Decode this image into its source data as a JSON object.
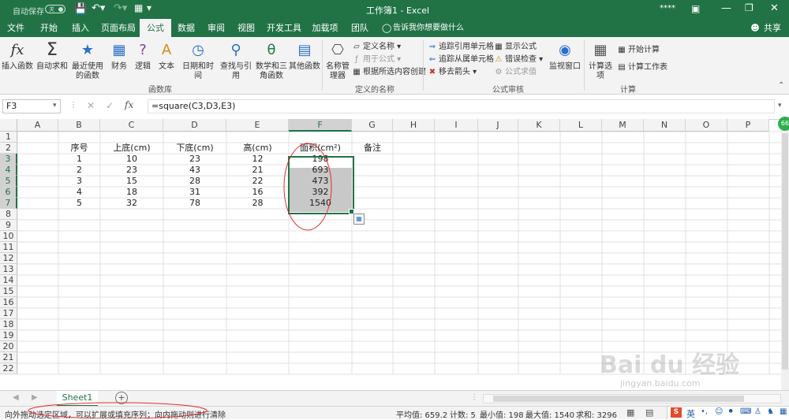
{
  "titlebar": {
    "autosave_label": "自动保存",
    "autosave_state": "关",
    "title": "工作簿1 - Excel",
    "user": "****",
    "bg_color": "#217346"
  },
  "tabs": [
    "文件",
    "开始",
    "插入",
    "页面布局",
    "公式",
    "数据",
    "审阅",
    "视图",
    "开发工具",
    "加载项",
    "团队"
  ],
  "active_tab": "公式",
  "tell_me": "告诉我你想要做什么",
  "share": "共享",
  "ribbon": {
    "function_library": {
      "label": "函数库",
      "insert_function": "插入函数",
      "autosum": "自动求和",
      "recent": "最近使用的函数",
      "financial": "财务",
      "logical": "逻辑",
      "text": "文本",
      "datetime": "日期和时间",
      "lookup": "查找与引用",
      "math": "数学和三角函数",
      "more": "其他函数"
    },
    "defined_names": {
      "label": "定义的名称",
      "name_manager": "名称管理器",
      "define_name": "定义名称",
      "use_in_formula": "用于公式",
      "create_from_selection": "根据所选内容创建"
    },
    "formula_auditing": {
      "label": "公式审核",
      "trace_precedents": "追踪引用单元格",
      "trace_dependents": "追踪从属单元格",
      "remove_arrows": "移去箭头",
      "show_formulas": "显示公式",
      "error_checking": "错误检查",
      "evaluate_formula": "公式求值",
      "watch_window": "监视窗口"
    },
    "calculation": {
      "label": "计算",
      "options": "计算选项",
      "calc_now": "开始计算",
      "calc_sheet": "计算工作表"
    }
  },
  "formula_bar": {
    "name_box": "F3",
    "formula": "=square(C3,D3,E3)"
  },
  "grid": {
    "columns": [
      "A",
      "B",
      "C",
      "D",
      "E",
      "F",
      "G",
      "H",
      "I",
      "J",
      "K",
      "L",
      "M",
      "N",
      "O",
      "P"
    ],
    "selected_column": "F",
    "rows": [
      "1",
      "2",
      "3",
      "4",
      "5",
      "6",
      "7",
      "8",
      "9",
      "10",
      "11",
      "12",
      "13",
      "14",
      "15",
      "16",
      "17",
      "18",
      "19",
      "20",
      "21",
      "22"
    ],
    "selected_rows": [
      "3",
      "4",
      "5",
      "6",
      "7"
    ],
    "headers": {
      "B": "序号",
      "C": "上底(cm)",
      "D": "下底(cm)",
      "E": "高(cm)",
      "F": "面积(cm²)",
      "G": "备注"
    },
    "data": [
      {
        "B": "1",
        "C": "10",
        "D": "23",
        "E": "12",
        "F": "198"
      },
      {
        "B": "2",
        "C": "23",
        "D": "43",
        "E": "21",
        "F": "693"
      },
      {
        "B": "3",
        "C": "15",
        "D": "28",
        "E": "22",
        "F": "473"
      },
      {
        "B": "4",
        "C": "18",
        "D": "31",
        "E": "16",
        "F": "392"
      },
      {
        "B": "5",
        "C": "32",
        "D": "78",
        "E": "28",
        "F": "1540"
      }
    ]
  },
  "sheet_tabs": [
    "Sheet1"
  ],
  "statusbar": {
    "message": "向外拖动选定区域，可以扩展或填充序列；向内拖动则进行清除",
    "average": "平均值: 659.2",
    "count": "计数: 5",
    "min": "最小值: 198",
    "max": "最大值: 1540",
    "sum": "求和: 3296",
    "ime": "英"
  },
  "watermark": {
    "brand": "Bai du 经验",
    "url": "jingyan.baidu.com"
  },
  "badge": "66",
  "colors": {
    "accent": "#217346",
    "annotation": "#e03030"
  }
}
